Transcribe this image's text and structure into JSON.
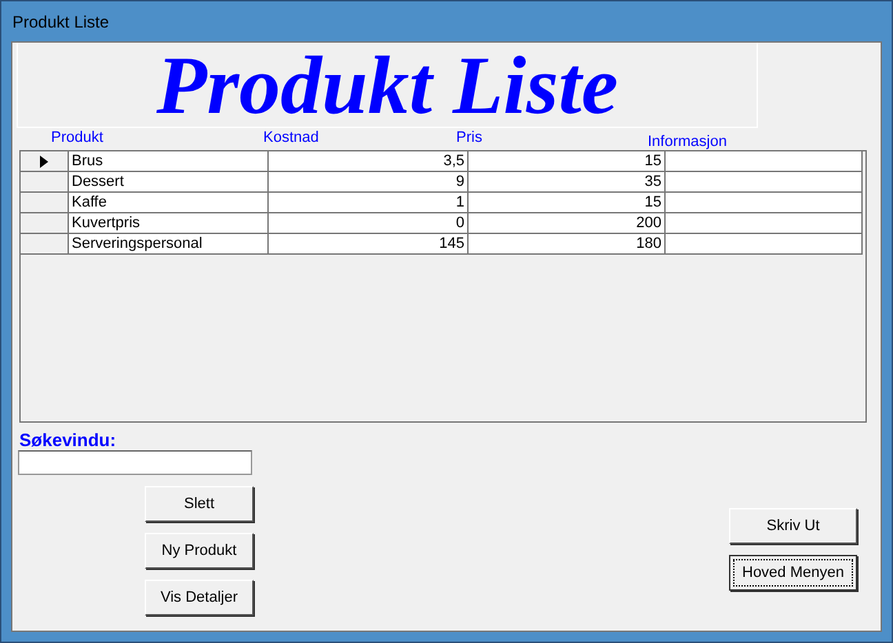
{
  "window": {
    "title": "Produkt Liste"
  },
  "banner": {
    "title": "Produkt Liste"
  },
  "field_labels": [
    "Produkt",
    "Kostnad",
    "Pris",
    "Informasjon"
  ],
  "table": {
    "rows": [
      {
        "cells": [
          "Brus",
          "3,5",
          "15",
          ""
        ],
        "selected": true
      },
      {
        "cells": [
          "Dessert",
          "9",
          "35",
          ""
        ],
        "selected": false
      },
      {
        "cells": [
          "Kaffe",
          "1",
          "15",
          ""
        ],
        "selected": false
      },
      {
        "cells": [
          "Kuvertpris",
          "0",
          "200",
          ""
        ],
        "selected": false
      },
      {
        "cells": [
          "Serveringspersonal",
          "145",
          "180",
          ""
        ],
        "selected": false
      }
    ]
  },
  "search": {
    "label": "Søkevindu:"
  },
  "left_buttons": [
    {
      "label": "Slett",
      "focused": false
    },
    {
      "label": "Ny Produkt",
      "focused": false
    },
    {
      "label": "Vis Detaljer",
      "focused": false
    }
  ],
  "right_buttons": [
    {
      "label": "Skriv Ut",
      "focused": false
    },
    {
      "label": "Hoved Menyen",
      "focused": true
    }
  ]
}
